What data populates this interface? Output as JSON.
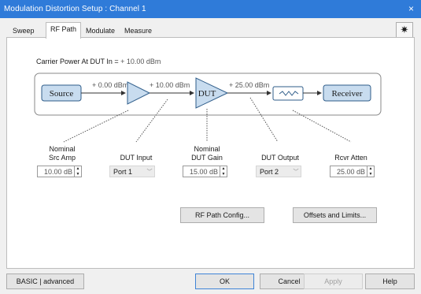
{
  "window": {
    "title": "Modulation Distortion Setup : Channel 1",
    "close_glyph": "×"
  },
  "tabs": [
    {
      "label": "Sweep",
      "active": false
    },
    {
      "label": "RF Path",
      "active": true
    },
    {
      "label": "Modulate",
      "active": false
    },
    {
      "label": "Measure",
      "active": false
    }
  ],
  "gear_glyph": "✷",
  "carrier": {
    "label": "Carrier Power At DUT In =",
    "value": "+ 10.00 dBm"
  },
  "diagram": {
    "source": "Source",
    "dut": "DUT",
    "receiver": "Receiver",
    "power_after_source": "+ 0.00 dBm",
    "power_after_amp": "+ 10.00 dBm",
    "power_after_dut": "+ 25.00 dBm"
  },
  "controls": {
    "src_amp": {
      "label_line1": "Nominal",
      "label_line2": "Src Amp",
      "value": "10.00 dB"
    },
    "dut_input": {
      "label": "DUT Input",
      "value": "Port 1"
    },
    "dut_gain": {
      "label_line1": "Nominal",
      "label_line2": "DUT Gain",
      "value": "15.00 dB"
    },
    "dut_output": {
      "label": "DUT Output",
      "value": "Port 2"
    },
    "rcvr_atten": {
      "label": "Rcvr Atten",
      "value": "25.00 dB"
    }
  },
  "buttons": {
    "rf_path_config": "RF Path Config...",
    "offsets_limits": "Offsets and Limits...",
    "mode": "BASIC | advanced",
    "ok": "OK",
    "cancel": "Cancel",
    "apply": "Apply",
    "help": "Help"
  },
  "colors": {
    "titlebar": "#2f7bd9",
    "block_fill": "#c8dcef",
    "block_stroke": "#2f5d8a"
  }
}
